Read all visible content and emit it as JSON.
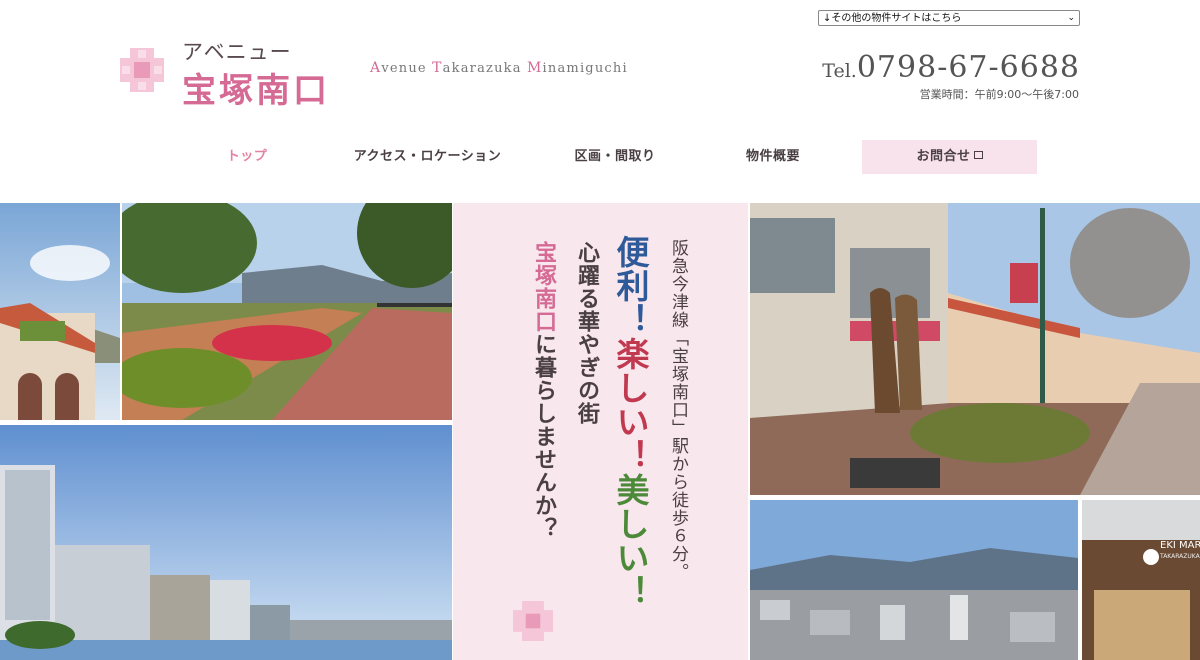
{
  "header": {
    "site_select": "↓その他の物件サイトはこちら",
    "logo_kana": "アベニュー",
    "logo_name": "宝塚南口",
    "logo_roman": [
      {
        "cap": "A",
        "rest": "venue "
      },
      {
        "cap": "T",
        "rest": "akarazuka "
      },
      {
        "cap": "M",
        "rest": "inamiguchi"
      }
    ],
    "tel_label": "Tel.",
    "tel_number": "0798-67-6688",
    "hours": "営業時間：午前9:00～午後7:00"
  },
  "nav": {
    "top": "トップ",
    "access": "アクセス・ロケーション",
    "plan": "区画・間取り",
    "overview": "物件概要",
    "contact": "お問合せ"
  },
  "hero": {
    "line1": "阪急今津線「宝塚南口」駅から徒歩６分。",
    "line2a": "便利！",
    "line2b": "楽しい！",
    "line2c": "美しい！",
    "line3": "心躍る華やぎの街",
    "line4a": "宝塚南口",
    "line4b": "に暮らしませんか？",
    "sign_text": "EKI MARCHE",
    "sign_sub": "TAKARAZUKA"
  },
  "colors": {
    "pink": "#d56a95",
    "blue": "#2f5a9a",
    "red": "#c0394f",
    "green": "#4c8a3a",
    "panel": "#f9e7ee"
  }
}
